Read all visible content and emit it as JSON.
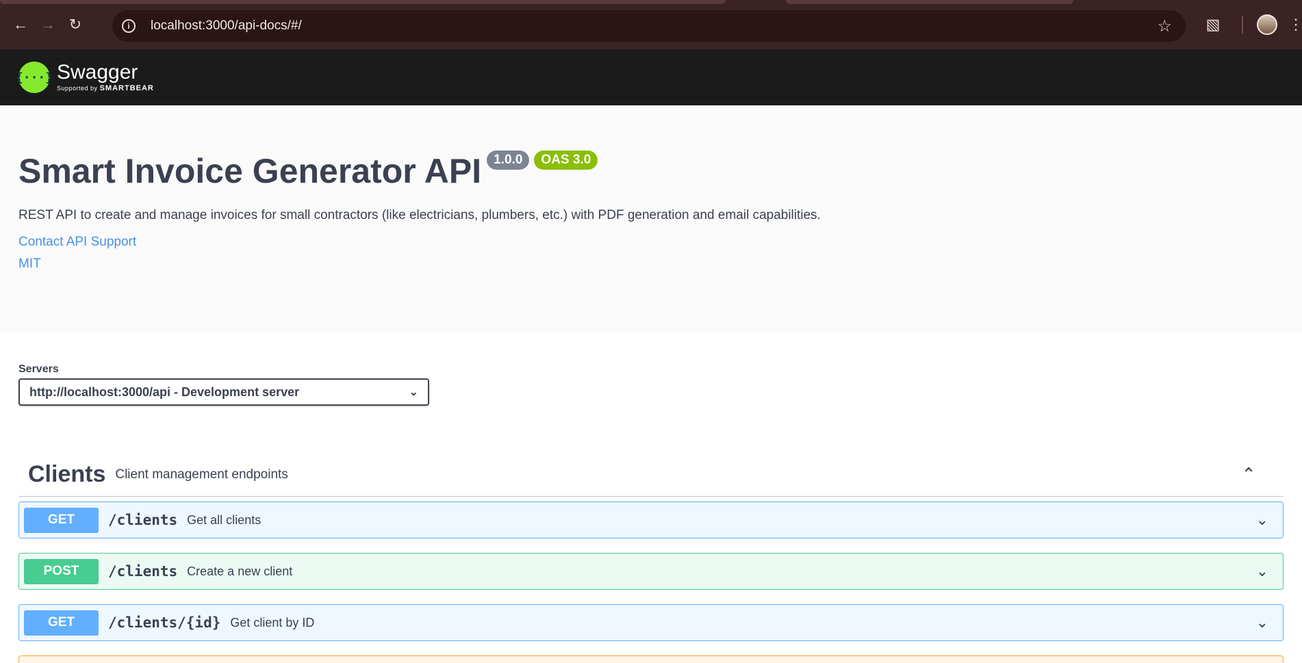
{
  "browser": {
    "url": "localhost:3000/api-docs/#/",
    "icons": [
      "back-icon",
      "forward-icon",
      "reload-icon",
      "site-info-icon",
      "bookmark-star-icon",
      "extensions-icon",
      "profile-avatar",
      "menu-icon"
    ]
  },
  "swagger": {
    "logo_name": "Swagger",
    "logo_supported": "Supported by",
    "logo_company": "SMARTBEAR"
  },
  "info": {
    "title": "Smart Invoice Generator API",
    "version": "1.0.0",
    "oas": "OAS 3.0",
    "description": "REST API to create and manage invoices for small contractors (like electricians, plumbers, etc.) with PDF generation and email capabilities.",
    "contact_link": "Contact API Support",
    "license_link": "MIT"
  },
  "servers": {
    "label": "Servers",
    "selected": "http://localhost:3000/api - Development server"
  },
  "tag": {
    "name": "Clients",
    "description": "Client management endpoints",
    "operations": [
      {
        "method": "GET",
        "path": "/clients",
        "summary": "Get all clients"
      },
      {
        "method": "POST",
        "path": "/clients",
        "summary": "Create a new client"
      },
      {
        "method": "GET",
        "path": "/clients/{id}",
        "summary": "Get client by ID"
      }
    ]
  },
  "colors": {
    "get": "#61affe",
    "post": "#49cc90",
    "put": "#fca130",
    "link": "#4990e2",
    "version_badge": "#7d8492",
    "oas_badge": "#89bf04"
  }
}
